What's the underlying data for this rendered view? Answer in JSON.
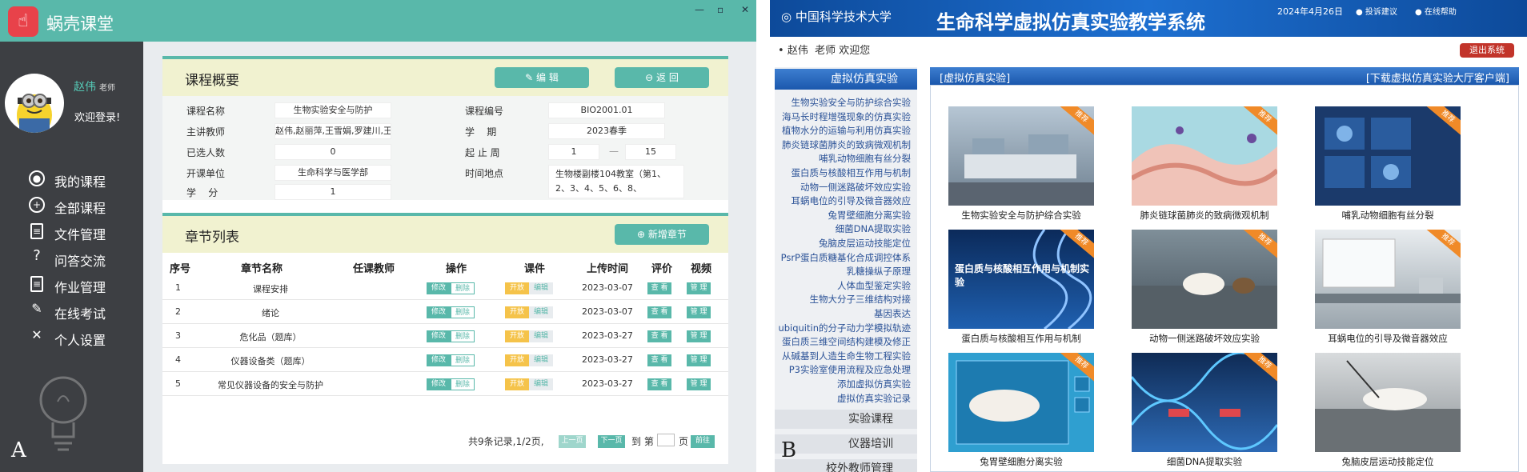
{
  "panelA": {
    "app_title": "蜗壳课堂",
    "user_name": "赵伟",
    "user_role": "老师",
    "welcome": "欢迎登录!",
    "panel_letter": "A",
    "nav": [
      {
        "label": "我的课程",
        "icon": "user-circle-icon"
      },
      {
        "label": "全部课程",
        "icon": "plus-circle-icon"
      },
      {
        "label": "文件管理",
        "icon": "file-icon"
      },
      {
        "label": "问答交流",
        "icon": "question-icon"
      },
      {
        "label": "作业管理",
        "icon": "clipboard-icon"
      },
      {
        "label": "在线考试",
        "icon": "pencil-icon"
      },
      {
        "label": "个人设置",
        "icon": "tools-icon"
      }
    ],
    "overview": {
      "title": "课程概要",
      "edit_label": "编 辑",
      "back_label": "返 回",
      "fields": {
        "course_name_label": "课程名称",
        "course_name": "生物实验安全与防护",
        "teacher_label": "主讲教师",
        "teacher": "赵伟,赵丽萍,王雪娟,罗建川,王剑",
        "selected_label": "已选人数",
        "selected": "0",
        "unit_label": "开课单位",
        "unit": "生命科学与医学部",
        "credit_label": "学    分",
        "credit": "1",
        "code_label": "课程编号",
        "code": "BIO2001.01",
        "term_label": "学    期",
        "term": "2023春季",
        "weeks_label": "起 止 周",
        "week_start": "1",
        "week_sep": "—",
        "week_end": "15",
        "place_label": "时间地点",
        "place": "生物楼副楼104教室（第1、2、3、4、5、6、8、"
      }
    },
    "chapters": {
      "title": "章节列表",
      "add_label": "新增章节",
      "columns": [
        "序号",
        "章节名称",
        "任课教师",
        "操作",
        "课件",
        "上传时间",
        "评价",
        "视频"
      ],
      "op_edit": "修改",
      "op_delete": "删除",
      "cw_open": "开放",
      "cw_edit": "编辑",
      "review": "查 看",
      "video": "管 理",
      "rows": [
        {
          "no": "1",
          "name": "课程安排",
          "date": "2023-03-07"
        },
        {
          "no": "2",
          "name": "绪论",
          "date": "2023-03-07"
        },
        {
          "no": "3",
          "name": "危化品（题库）",
          "date": "2023-03-27"
        },
        {
          "no": "4",
          "name": "仪器设备类（题库）",
          "date": "2023-03-27"
        },
        {
          "no": "5",
          "name": "常见仪器设备的安全与防护",
          "date": "2023-03-27"
        }
      ]
    },
    "pager": {
      "summary": "共9条记录,1/2页,",
      "prev": "上一页",
      "next": "下一页",
      "goto": "到 第",
      "page_unit": "页",
      "go": "前往"
    }
  },
  "panelB": {
    "university": "中国科学技术大学",
    "system_title": "生命科学虚拟仿真实验教学系统",
    "date": "2024年4月26日",
    "feedback": "投诉建议",
    "help": "在线帮助",
    "user": "赵伟",
    "role": "老师",
    "welcome": "欢迎您",
    "exit": "退出系统",
    "panel_letter": "B",
    "menu_title": "虚拟仿真实验",
    "menu_items": [
      "生物实验安全与防护综合实验",
      "海马长时程增强现象的仿真实验",
      "植物水分的运输与利用仿真实验",
      "肺炎链球菌肺炎的致病微观机制",
      "哺乳动物细胞有丝分裂",
      "蛋白质与核酸相互作用与机制",
      "动物一侧迷路破坏效应实验",
      "耳蜗电位的引导及微音器效应",
      "兔胃壁细胞分离实验",
      "细菌DNA提取实验",
      "兔脑皮层运动技能定位",
      "PsrP蛋白质糖基化合成调控体系",
      "乳糖操纵子原理",
      "人体血型鉴定实验",
      "生物大分子三维结构对接",
      "基因表达",
      "ubiquitin的分子动力学模拟轨迹",
      "蛋白质三维空间结构建模及修正",
      "从碱基到人造生命生物工程实验",
      "P3实验室使用流程及应急处理",
      "添加虚拟仿真实验",
      "虚拟仿真实验记录"
    ],
    "sections": [
      "实验课程",
      "仪器培训",
      "校外教师管理"
    ],
    "tab_left": "[虚拟仿真实验]",
    "tab_right": "[下载虚拟仿真实验大厅客户端]",
    "badge": "推荐",
    "tiles": [
      {
        "caption": "生物实验安全与防护综合实验",
        "tile_text": ""
      },
      {
        "caption": "肺炎链球菌肺炎的致病微观机制",
        "tile_text": ""
      },
      {
        "caption": "哺乳动物细胞有丝分裂",
        "tile_text": ""
      },
      {
        "caption": "蛋白质与核酸相互作用与机制",
        "tile_text": "蛋白质与核酸相互作用与机制实验"
      },
      {
        "caption": "动物一侧迷路破坏效应实验",
        "tile_text": ""
      },
      {
        "caption": "耳蜗电位的引导及微音器效应",
        "tile_text": ""
      },
      {
        "caption": "兔胃壁细胞分离实验",
        "tile_text": ""
      },
      {
        "caption": "细菌DNA提取实验",
        "tile_text": ""
      },
      {
        "caption": "兔脑皮层运动技能定位",
        "tile_text": ""
      }
    ]
  }
}
